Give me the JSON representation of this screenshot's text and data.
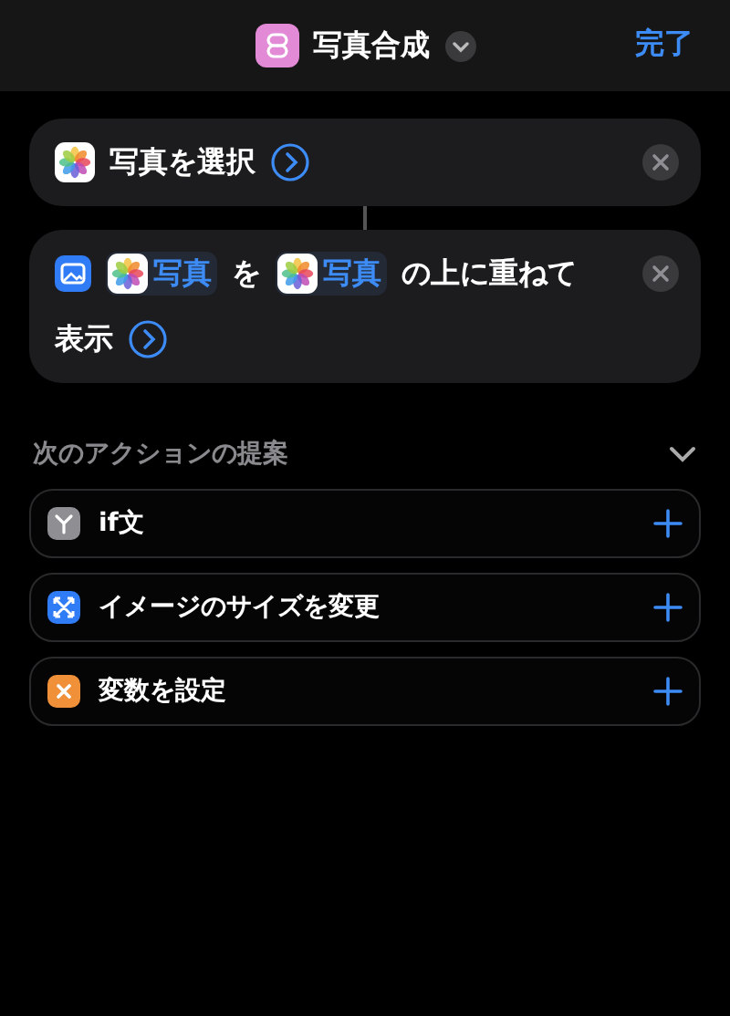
{
  "header": {
    "title": "写真合成",
    "done": "完了"
  },
  "actions": [
    {
      "parts": [
        {
          "kind": "app_icon"
        },
        {
          "kind": "text",
          "text": "写真を選択"
        },
        {
          "kind": "more"
        }
      ]
    },
    {
      "parts": [
        {
          "kind": "action_icon"
        },
        {
          "kind": "token",
          "text": "写真"
        },
        {
          "kind": "text",
          "text": "を"
        },
        {
          "kind": "token",
          "text": "写真"
        },
        {
          "kind": "text",
          "text": "の上に重ねて"
        },
        {
          "kind": "line_break"
        },
        {
          "kind": "text",
          "text": "表示"
        },
        {
          "kind": "more"
        }
      ]
    }
  ],
  "suggestions": {
    "title": "次のアクションの提案",
    "expanded": true,
    "items": [
      {
        "kind": "branch",
        "color": "#8e8e93",
        "label": "if文"
      },
      {
        "kind": "resize",
        "color": "#2f7cf6",
        "label": "イメージのサイズを変更"
      },
      {
        "kind": "variable",
        "color": "#f0913a",
        "label": "変数を設定"
      }
    ]
  }
}
